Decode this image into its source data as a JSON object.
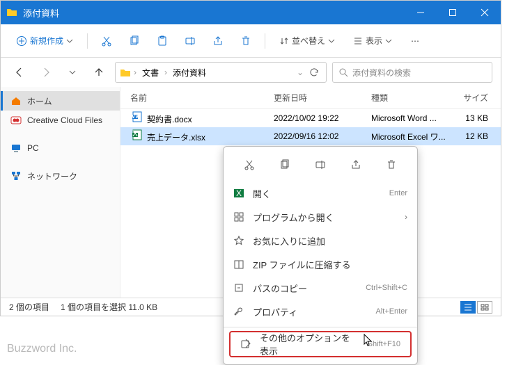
{
  "window": {
    "title": "添付資料"
  },
  "toolbar": {
    "new": "新規作成",
    "sort": "並べ替え",
    "view": "表示"
  },
  "breadcrumb": {
    "item1": "文書",
    "item2": "添付資料"
  },
  "search": {
    "placeholder": "添付資料の検索"
  },
  "sidebar": {
    "home": "ホーム",
    "ccf": "Creative Cloud Files",
    "pc": "PC",
    "network": "ネットワーク"
  },
  "columns": {
    "name": "名前",
    "date": "更新日時",
    "type": "種類",
    "size": "サイズ"
  },
  "files": [
    {
      "name": "契約書.docx",
      "date": "2022/10/02 19:22",
      "type": "Microsoft Word ...",
      "size": "13 KB"
    },
    {
      "name": "売上データ.xlsx",
      "date": "2022/09/16 12:02",
      "type": "Microsoft Excel ワ...",
      "size": "12 KB"
    }
  ],
  "status": {
    "count": "2 個の項目",
    "selected": "1 個の項目を選択  11.0 KB"
  },
  "ctx": {
    "open": "開く",
    "open_sc": "Enter",
    "openwith": "プログラムから開く",
    "fav": "お気に入りに追加",
    "zip": "ZIP ファイルに圧縮する",
    "copypath": "パスのコピー",
    "copypath_sc": "Ctrl+Shift+C",
    "props": "プロパティ",
    "props_sc": "Alt+Enter",
    "more": "その他のオプションを表示",
    "more_sc": "Shift+F10"
  },
  "watermark": "Buzzword Inc."
}
